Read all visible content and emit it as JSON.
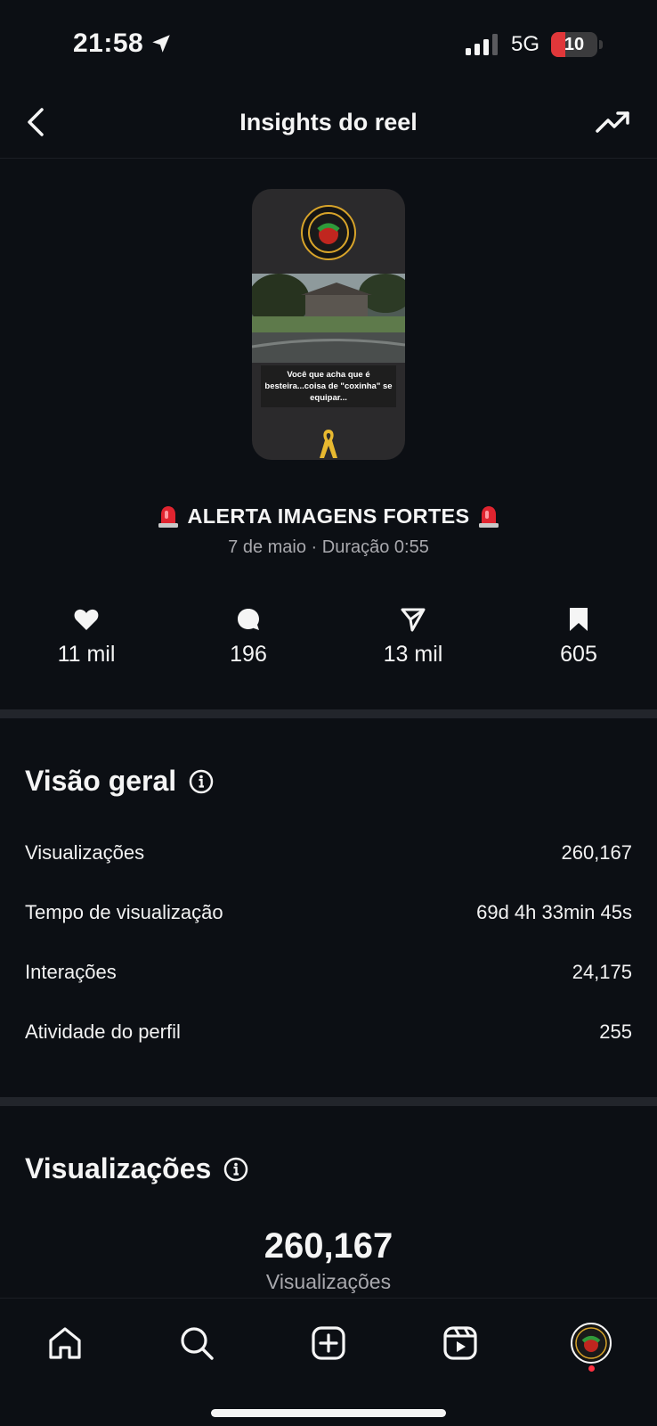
{
  "status_bar": {
    "time": "21:58",
    "network": "5G",
    "battery": "10",
    "battery_level": 0.1,
    "battery_color": "#e0373a"
  },
  "header": {
    "title": "Insights do reel",
    "back_icon": "chevron-left-icon",
    "trend_icon": "trending-up-icon"
  },
  "reel": {
    "thumbnail_caption": "Você que acha que é besteira...coisa de \"coxinha\" se equipar...",
    "title": "ALERTA IMAGENS FORTES",
    "meta": "7 de maio · Duração 0:55"
  },
  "stats": [
    {
      "icon": "heart-icon",
      "value": "11 mil"
    },
    {
      "icon": "comment-icon",
      "value": "196"
    },
    {
      "icon": "share-icon",
      "value": "13 mil"
    },
    {
      "icon": "bookmark-icon",
      "value": "605"
    }
  ],
  "overview": {
    "title": "Visão geral",
    "rows": [
      {
        "label": "Visualizações",
        "value": "260,167"
      },
      {
        "label": "Tempo de visualização",
        "value": "69d 4h 33min 45s"
      },
      {
        "label": "Interações",
        "value": "24,175"
      },
      {
        "label": "Atividade do perfil",
        "value": "255"
      }
    ]
  },
  "views": {
    "title": "Visualizações",
    "total": "260,167",
    "label": "Visualizações"
  },
  "nav": {
    "items": [
      "home-icon",
      "search-icon",
      "create-icon",
      "reels-icon",
      "profile-avatar"
    ]
  },
  "colors": {
    "background": "#0c0f14",
    "divider": "#22252b",
    "secondary_text": "#a8a8ad",
    "notification_dot": "#ff3040"
  }
}
